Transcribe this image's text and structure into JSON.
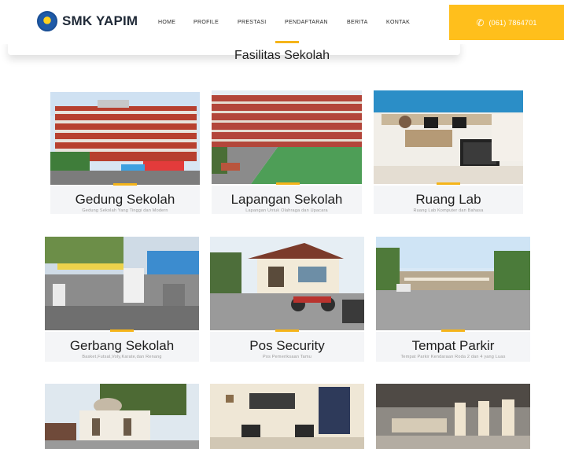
{
  "header": {
    "brand": "SMK YAPIM",
    "nav": [
      "HOME",
      "PROFILE",
      "PRESTASI",
      "PENDAFTARAN",
      "BERITA",
      "KONTAK"
    ],
    "phone": "(061) 7864701"
  },
  "section": {
    "title": "Fasilitas Sekolah"
  },
  "cards": [
    {
      "title": "Gedung Sekolah",
      "subtitle": "Gedung Sekolah Yang Tinggi dan Modern"
    },
    {
      "title": "Lapangan Sekolah",
      "subtitle": "Lapangan Untuk Olahraga dan Upacara"
    },
    {
      "title": "Ruang Lab",
      "subtitle": "Ruang Lab Komputer dan Bahasa"
    },
    {
      "title": "Gerbang Sekolah",
      "subtitle": "Basket,Futsal,Voly,Karate,dan Renang"
    },
    {
      "title": "Pos Security",
      "subtitle": "Pos Pemeriksaan Tamu"
    },
    {
      "title": "Tempat Parkir",
      "subtitle": "Tempat Parkir Kendaraan Roda 2 dan 4 yang Luas"
    }
  ],
  "colors": {
    "accent": "#ffbf1c",
    "caption_bg": "#f4f5f7"
  }
}
